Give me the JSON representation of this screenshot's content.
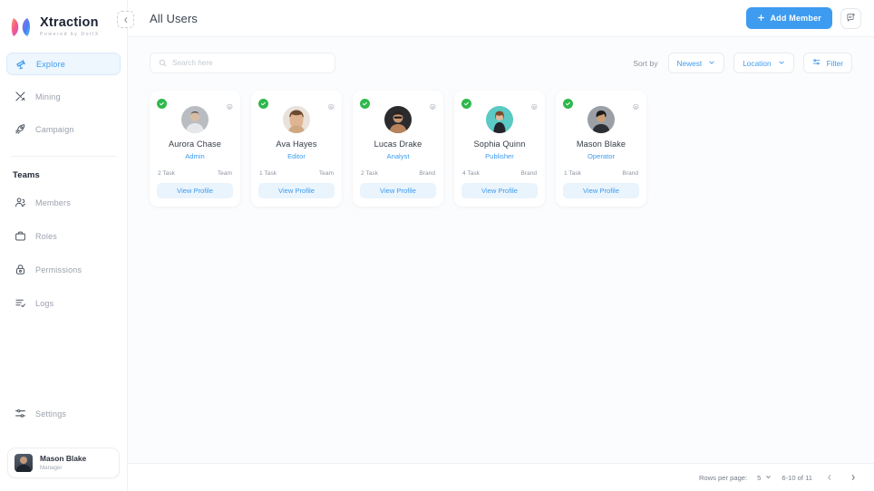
{
  "brand": {
    "name": "Xtraction",
    "tagline": "Powered by DotIX",
    "accent_color": "#3d9bf0",
    "logo_icon": "xtraction-logo-mark"
  },
  "sidebar": {
    "main_items": [
      {
        "label": "Explore",
        "icon": "telescope-icon",
        "active": true
      },
      {
        "label": "Mining",
        "icon": "tools-icon",
        "active": false
      },
      {
        "label": "Campaign",
        "icon": "rocket-icon",
        "active": false
      }
    ],
    "teams_section_title": "Teams",
    "teams_items": [
      {
        "label": "Members",
        "icon": "users-icon"
      },
      {
        "label": "Roles",
        "icon": "briefcase-icon"
      },
      {
        "label": "Permissions",
        "icon": "lock-icon"
      },
      {
        "label": "Logs",
        "icon": "list-check-icon"
      }
    ],
    "settings_item": {
      "label": "Settings",
      "icon": "sliders-icon"
    },
    "account": {
      "name": "Mason Blake",
      "role": "Manager",
      "avatar_icon": "user-avatar"
    }
  },
  "topbar": {
    "collapse_icon": "chevron-left-icon",
    "title": "All Users",
    "add_button_label": "Add Member",
    "add_button_icon": "plus-icon",
    "notification_icon": "message-notification-icon"
  },
  "toolbar": {
    "search": {
      "placeholder": "Search here",
      "value": "",
      "icon": "search-icon"
    },
    "sort_by_label": "Sort by",
    "sort_value": "Newest",
    "location_value": "Location",
    "filter_label": "Filter",
    "filter_icon": "filter-icon",
    "chevron_icon": "chevron-down-icon"
  },
  "users": [
    {
      "name": "Aurora Chase",
      "role": "Admin",
      "tasks": "2 Task",
      "group": "Team",
      "verified": true,
      "action_label": "View Profile",
      "gear_icon": "gear-icon",
      "check_icon": "check-circle-icon",
      "avatar_bg": "#b9bdc2",
      "avatar_skin": "#d8bda4",
      "avatar_hair": "#4a4a4d",
      "avatar_shirt": "#e6e7ea"
    },
    {
      "name": "Ava Hayes",
      "role": "Editor",
      "tasks": "1 Task",
      "group": "Team",
      "verified": true,
      "action_label": "View Profile",
      "gear_icon": "gear-icon",
      "check_icon": "check-circle-icon",
      "avatar_bg": "#e8e2da",
      "avatar_skin": "#e0b493",
      "avatar_hair": "#6d4a2f",
      "avatar_shirt": "#cfa882"
    },
    {
      "name": "Lucas Drake",
      "role": "Analyst",
      "tasks": "2 Task",
      "group": "Brand",
      "verified": true,
      "action_label": "View Profile",
      "gear_icon": "gear-icon",
      "check_icon": "check-circle-icon",
      "avatar_bg": "#2b2b2e",
      "avatar_skin": "#c99873",
      "avatar_hair": "#2a2320",
      "avatar_shirt": "#b8835c"
    },
    {
      "name": "Sophia Quinn",
      "role": "Publisher",
      "tasks": "4 Task",
      "group": "Brand",
      "verified": true,
      "action_label": "View Profile",
      "gear_icon": "gear-icon",
      "check_icon": "check-circle-icon",
      "avatar_bg": "#5bc9c4",
      "avatar_skin": "#e3b89a",
      "avatar_hair": "#7a4a2c",
      "avatar_shirt": "#24242a"
    },
    {
      "name": "Mason Blake",
      "role": "Operator",
      "tasks": "1 Task",
      "group": "Brand",
      "verified": true,
      "action_label": "View Profile",
      "gear_icon": "gear-icon",
      "check_icon": "check-circle-icon",
      "avatar_bg": "#9aa0a6",
      "avatar_skin": "#cc9e78",
      "avatar_hair": "#1f1d1c",
      "avatar_shirt": "#2c2f36"
    }
  ],
  "footer": {
    "rows_per_page_label": "Rows per page:",
    "rows_per_page_value": "5",
    "range_label": "6-10 of 11",
    "prev_icon": "chevron-left-icon",
    "next_icon": "chevron-right-icon"
  }
}
